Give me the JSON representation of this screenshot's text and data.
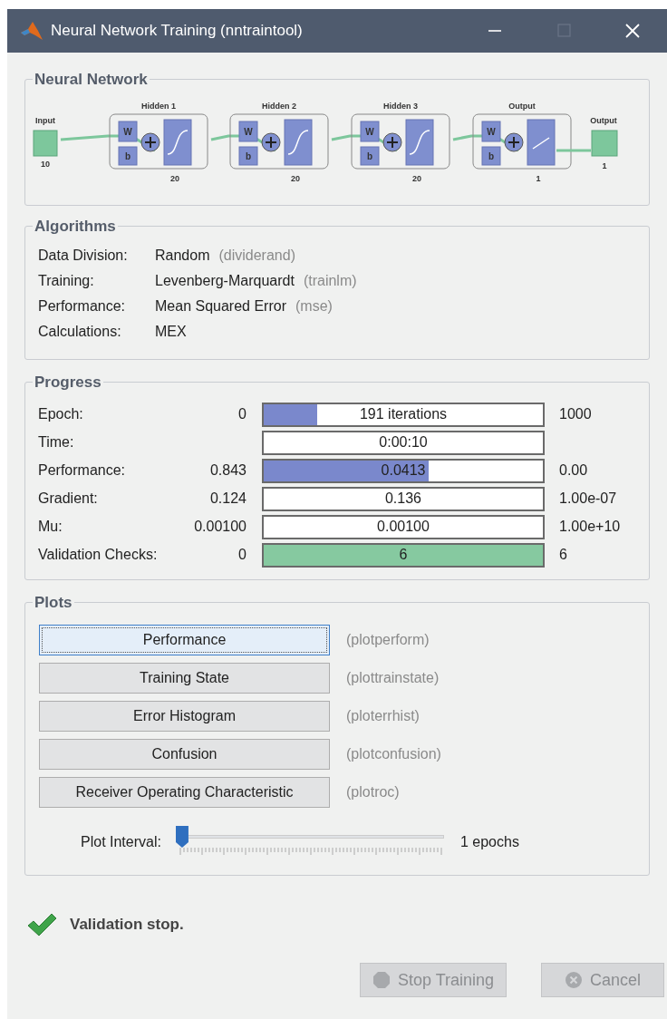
{
  "window": {
    "title": "Neural Network Training (nntraintool)",
    "controls": [
      {
        "kind": "minimize",
        "disabled": false
      },
      {
        "kind": "maximize",
        "disabled": true
      },
      {
        "kind": "close",
        "disabled": false
      }
    ]
  },
  "neural_network": {
    "title": "Neural Network",
    "input": {
      "label": "Input",
      "size": "10"
    },
    "output": {
      "label": "Output",
      "size": "1"
    },
    "layers": [
      {
        "title": "Hidden 1",
        "size": "20",
        "kind": "sigmoid",
        "weight_label": "W",
        "bias_label": "b"
      },
      {
        "title": "Hidden 2",
        "size": "20",
        "kind": "sigmoid",
        "weight_label": "W",
        "bias_label": "b"
      },
      {
        "title": "Hidden 3",
        "size": "20",
        "kind": "sigmoid",
        "weight_label": "W",
        "bias_label": "b"
      },
      {
        "title": "Output",
        "size": "1",
        "kind": "linear",
        "weight_label": "W",
        "bias_label": "b"
      }
    ]
  },
  "algorithms": {
    "title": "Algorithms",
    "rows": [
      {
        "label": "Data Division:",
        "value": "Random",
        "function": "(dividerand)"
      },
      {
        "label": "Training:",
        "value": "Levenberg-Marquardt",
        "function": "(trainlm)"
      },
      {
        "label": "Performance:",
        "value": "Mean Squared Error",
        "function": "(mse)"
      },
      {
        "label": "Calculations:",
        "value": "MEX"
      }
    ]
  },
  "progress": {
    "title": "Progress",
    "rows": [
      {
        "label": "Epoch:",
        "start": "0",
        "reading": "191 iterations",
        "end": "1000",
        "level": 0.19,
        "color": "#7a88cc"
      },
      {
        "label": "Time:",
        "reading": "0:00:10"
      },
      {
        "label": "Performance:",
        "start": "0.843",
        "reading": "0.0413",
        "end": "0.00",
        "level": 0.59,
        "color": "#7a88cc"
      },
      {
        "label": "Gradient:",
        "start": "0.124",
        "reading": "0.136",
        "end": "1.00e-07"
      },
      {
        "label": "Mu:",
        "start": "0.00100",
        "reading": "0.00100",
        "end": "1.00e+10"
      },
      {
        "label": "Validation Checks:",
        "start": "0",
        "reading": "6",
        "end": "6",
        "level": 1,
        "color": "#86c9a0"
      }
    ]
  },
  "plots": {
    "title": "Plots",
    "buttons": [
      {
        "label": "Performance",
        "function": "(plotperform)",
        "focused": true
      },
      {
        "label": "Training State",
        "function": "(plottrainstate)",
        "focused": false
      },
      {
        "label": "Error Histogram",
        "function": "(ploterrhist)",
        "focused": false
      },
      {
        "label": "Confusion",
        "function": "(plotconfusion)",
        "focused": false
      },
      {
        "label": "Receiver Operating Characteristic",
        "function": "(plotroc)",
        "focused": false
      }
    ],
    "interval": {
      "label": "Plot Interval:",
      "level": 0,
      "reading": "1 epochs"
    }
  },
  "status": {
    "message": "Validation stop."
  },
  "buttons": [
    {
      "kind": "stop",
      "label": "Stop Training",
      "disabled": true
    },
    {
      "kind": "cancel",
      "label": "Cancel",
      "disabled": true
    }
  ]
}
